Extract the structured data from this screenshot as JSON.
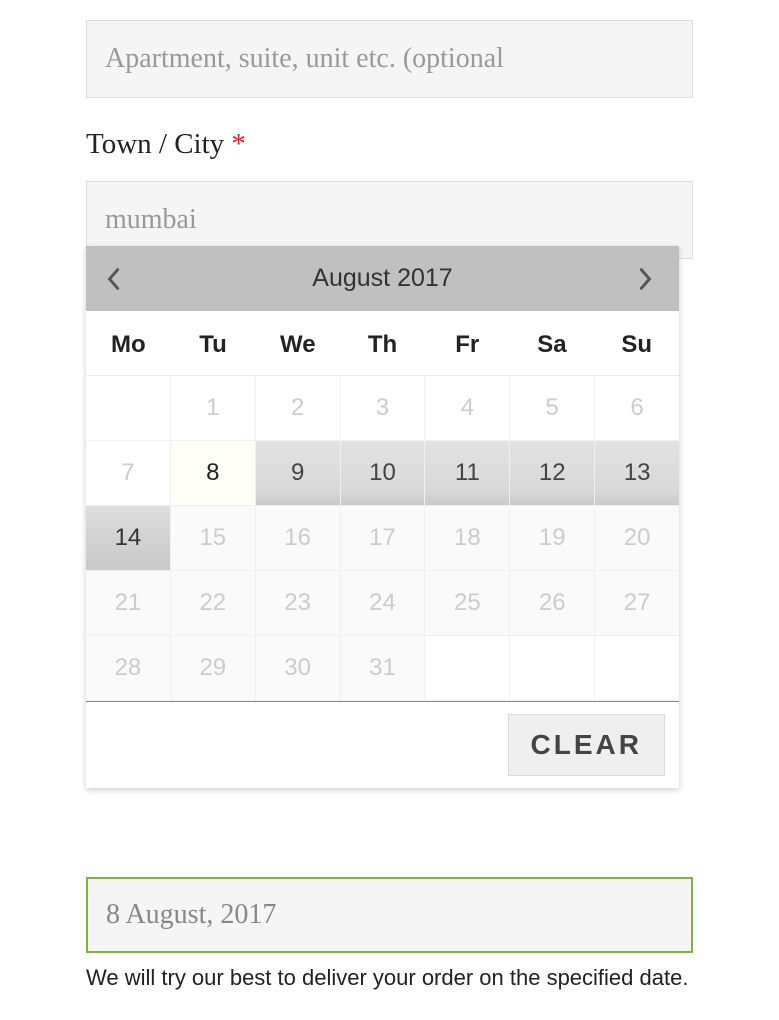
{
  "apartment": {
    "placeholder": "Apartment, suite, unit etc. (optional",
    "value": ""
  },
  "city": {
    "label": "Town / City",
    "required_marker": "*",
    "value": "mumbai"
  },
  "datepicker": {
    "title": "August 2017",
    "weekdays": [
      "Mo",
      "Tu",
      "We",
      "Th",
      "Fr",
      "Sa",
      "Su"
    ],
    "rows": [
      [
        {
          "d": "",
          "cls": "empty"
        },
        {
          "d": "1",
          "cls": "past"
        },
        {
          "d": "2",
          "cls": "past"
        },
        {
          "d": "3",
          "cls": "past"
        },
        {
          "d": "4",
          "cls": "past"
        },
        {
          "d": "5",
          "cls": "past"
        },
        {
          "d": "6",
          "cls": "past"
        }
      ],
      [
        {
          "d": "7",
          "cls": "past"
        },
        {
          "d": "8",
          "cls": "selected"
        },
        {
          "d": "9",
          "cls": "active"
        },
        {
          "d": "10",
          "cls": "active"
        },
        {
          "d": "11",
          "cls": "active"
        },
        {
          "d": "12",
          "cls": "active"
        },
        {
          "d": "13",
          "cls": "active"
        }
      ],
      [
        {
          "d": "14",
          "cls": "hovered"
        },
        {
          "d": "15",
          "cls": "disabled"
        },
        {
          "d": "16",
          "cls": "disabled"
        },
        {
          "d": "17",
          "cls": "disabled"
        },
        {
          "d": "18",
          "cls": "disabled"
        },
        {
          "d": "19",
          "cls": "disabled"
        },
        {
          "d": "20",
          "cls": "disabled"
        }
      ],
      [
        {
          "d": "21",
          "cls": "disabled"
        },
        {
          "d": "22",
          "cls": "disabled"
        },
        {
          "d": "23",
          "cls": "disabled"
        },
        {
          "d": "24",
          "cls": "disabled"
        },
        {
          "d": "25",
          "cls": "disabled"
        },
        {
          "d": "26",
          "cls": "disabled"
        },
        {
          "d": "27",
          "cls": "disabled"
        }
      ],
      [
        {
          "d": "28",
          "cls": "disabled"
        },
        {
          "d": "29",
          "cls": "disabled"
        },
        {
          "d": "30",
          "cls": "disabled"
        },
        {
          "d": "31",
          "cls": "disabled"
        },
        {
          "d": "",
          "cls": "empty"
        },
        {
          "d": "",
          "cls": "empty"
        },
        {
          "d": "",
          "cls": "empty"
        }
      ]
    ],
    "clear_label": "CLEAR"
  },
  "date_field": {
    "value": "8 August, 2017"
  },
  "help_text": "We will try our best to deliver your order on the specified date."
}
